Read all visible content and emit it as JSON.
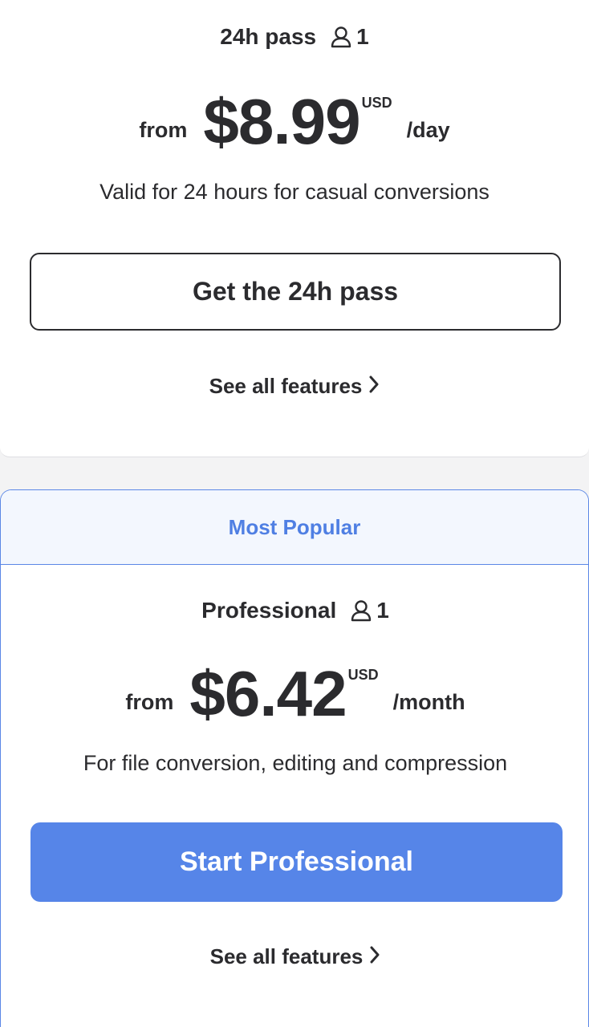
{
  "plans": [
    {
      "name": "24h pass",
      "seats": "1",
      "price_prefix": "from",
      "price": "$8.99",
      "currency": "USD",
      "period": "/day",
      "description": "Valid for 24 hours for casual conversions",
      "cta": "Get the 24h pass",
      "features_link": "See all features"
    },
    {
      "badge": "Most Popular",
      "name": "Professional",
      "seats": "1",
      "price_prefix": "from",
      "price": "$6.42",
      "currency": "USD",
      "period": "/month",
      "description": "For file conversion, editing and compression",
      "cta": "Start Professional",
      "features_link": "See all features"
    }
  ],
  "colors": {
    "accent": "#5685e8",
    "badge_text": "#4f7fe3",
    "badge_bg": "#f3f7fe",
    "text": "#2b2b2e",
    "page_bg": "#f3f3f4"
  },
  "icons": [
    "user-icon",
    "chevron-right-icon"
  ]
}
